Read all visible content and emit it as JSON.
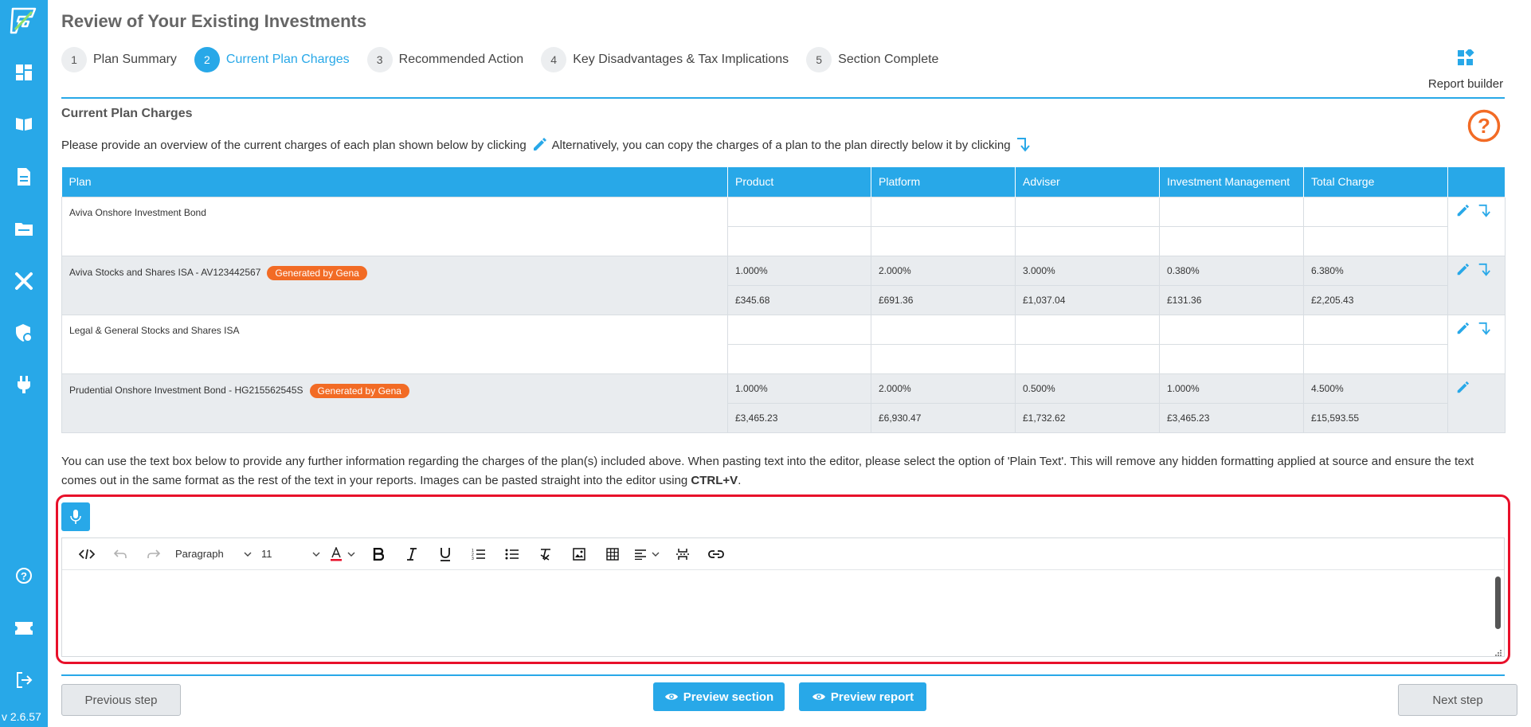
{
  "app": {
    "version": "v 2.6.57"
  },
  "colors": {
    "accent": "#28a8e8",
    "badge": "#f26b25",
    "highlight": "#e8102a"
  },
  "header": {
    "title": "Review of Your Existing Investments"
  },
  "steps": [
    {
      "num": "1",
      "label": "Plan Summary"
    },
    {
      "num": "2",
      "label": "Current Plan Charges",
      "active": true
    },
    {
      "num": "3",
      "label": "Recommended Action"
    },
    {
      "num": "4",
      "label": "Key Disadvantages & Tax Implications"
    },
    {
      "num": "5",
      "label": "Section Complete"
    }
  ],
  "report_builder": {
    "label": "Report builder"
  },
  "section": {
    "title": "Current Plan Charges",
    "intro_part1": "Please provide an overview of the current charges of each plan shown below by clicking",
    "intro_part2": "Alternatively, you can copy the charges of a plan to the plan directly below it by clicking"
  },
  "table": {
    "headers": [
      "Plan",
      "Product",
      "Platform",
      "Adviser",
      "Investment Management",
      "Total Charge"
    ],
    "rows": [
      {
        "plan": "Aviva Onshore Investment Bond",
        "badge": "",
        "pct": [
          "",
          "",
          "",
          "",
          ""
        ],
        "amt": [
          "",
          "",
          "",
          "",
          ""
        ]
      },
      {
        "plan": "Aviva Stocks and Shares ISA - AV123442567",
        "badge": "Generated by Gena",
        "pct": [
          "1.000%",
          "2.000%",
          "3.000%",
          "0.380%",
          "6.380%"
        ],
        "amt": [
          "£345.68",
          "£691.36",
          "£1,037.04",
          "£131.36",
          "£2,205.43"
        ]
      },
      {
        "plan": "Legal & General Stocks and Shares ISA",
        "badge": "",
        "pct": [
          "",
          "",
          "",
          "",
          ""
        ],
        "amt": [
          "",
          "",
          "",
          "",
          ""
        ]
      },
      {
        "plan": "Prudential Onshore Investment Bond - HG215562545S",
        "badge": "Generated by Gena",
        "pct": [
          "1.000%",
          "2.000%",
          "0.500%",
          "1.000%",
          "4.500%"
        ],
        "amt": [
          "£3,465.23",
          "£6,930.47",
          "£1,732.62",
          "£3,465.23",
          "£15,593.55"
        ]
      }
    ]
  },
  "notes": {
    "text": "You can use the text box below to provide any further information regarding the charges of the plan(s) included above. When pasting text into the editor, please select the option of 'Plain Text'. This will remove any hidden formatting applied at source and ensure the text comes out in the same format as the rest of the text in your reports. Images can be pasted straight into the editor using",
    "shortcut": "CTRL+V",
    "end": "."
  },
  "editor": {
    "block_format": "Paragraph",
    "font_size": "11",
    "content": ""
  },
  "footer": {
    "previous": "Previous step",
    "preview_section": "Preview section",
    "preview_report": "Preview report",
    "next": "Next step"
  }
}
